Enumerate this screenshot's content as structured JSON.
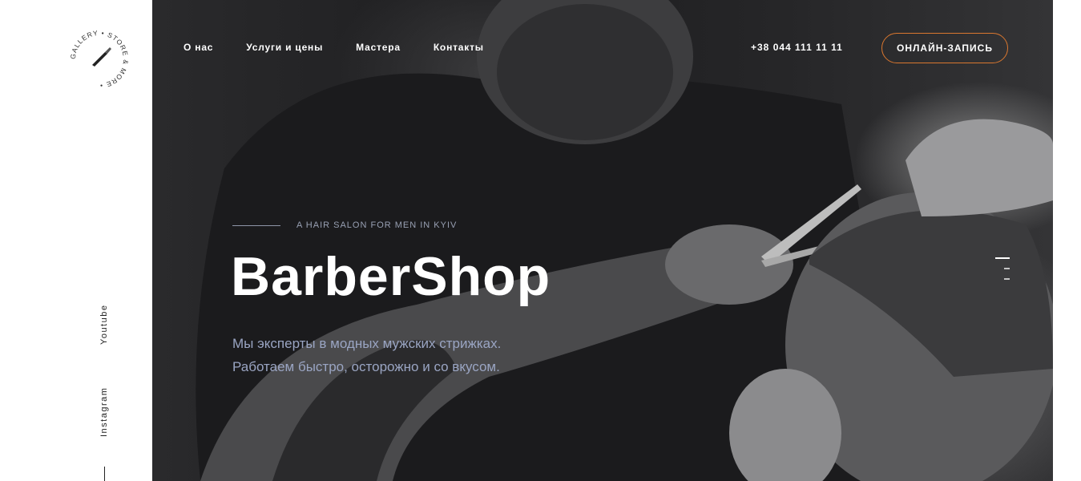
{
  "logo": {
    "ring_text": "GALLERY • STORE & MORE •"
  },
  "social": {
    "youtube": "Youtube",
    "instagram": "Instagram"
  },
  "nav": {
    "items": [
      "О нас",
      "Услуги и цены",
      "Мастера",
      "Контакты"
    ]
  },
  "header": {
    "phone": "+38 044 111 11 11",
    "cta_label": "ОНЛАЙН-ЗАПИСЬ"
  },
  "hero": {
    "eyebrow": "A HAIR SALON FOR MEN IN KYIV",
    "title": "BarberShop",
    "subtitle_line1": "Мы эксперты в модных мужских стрижках.",
    "subtitle_line2": "Работаем быстро, осторожно и со вкусом."
  },
  "colors": {
    "accent": "#d9772f",
    "subtitle": "#9aa5c3",
    "eyebrow": "#98a0b3"
  },
  "icons": {
    "logo": "razor-logo-icon"
  },
  "slider": {
    "slide_count": 3,
    "active_index": 0
  }
}
